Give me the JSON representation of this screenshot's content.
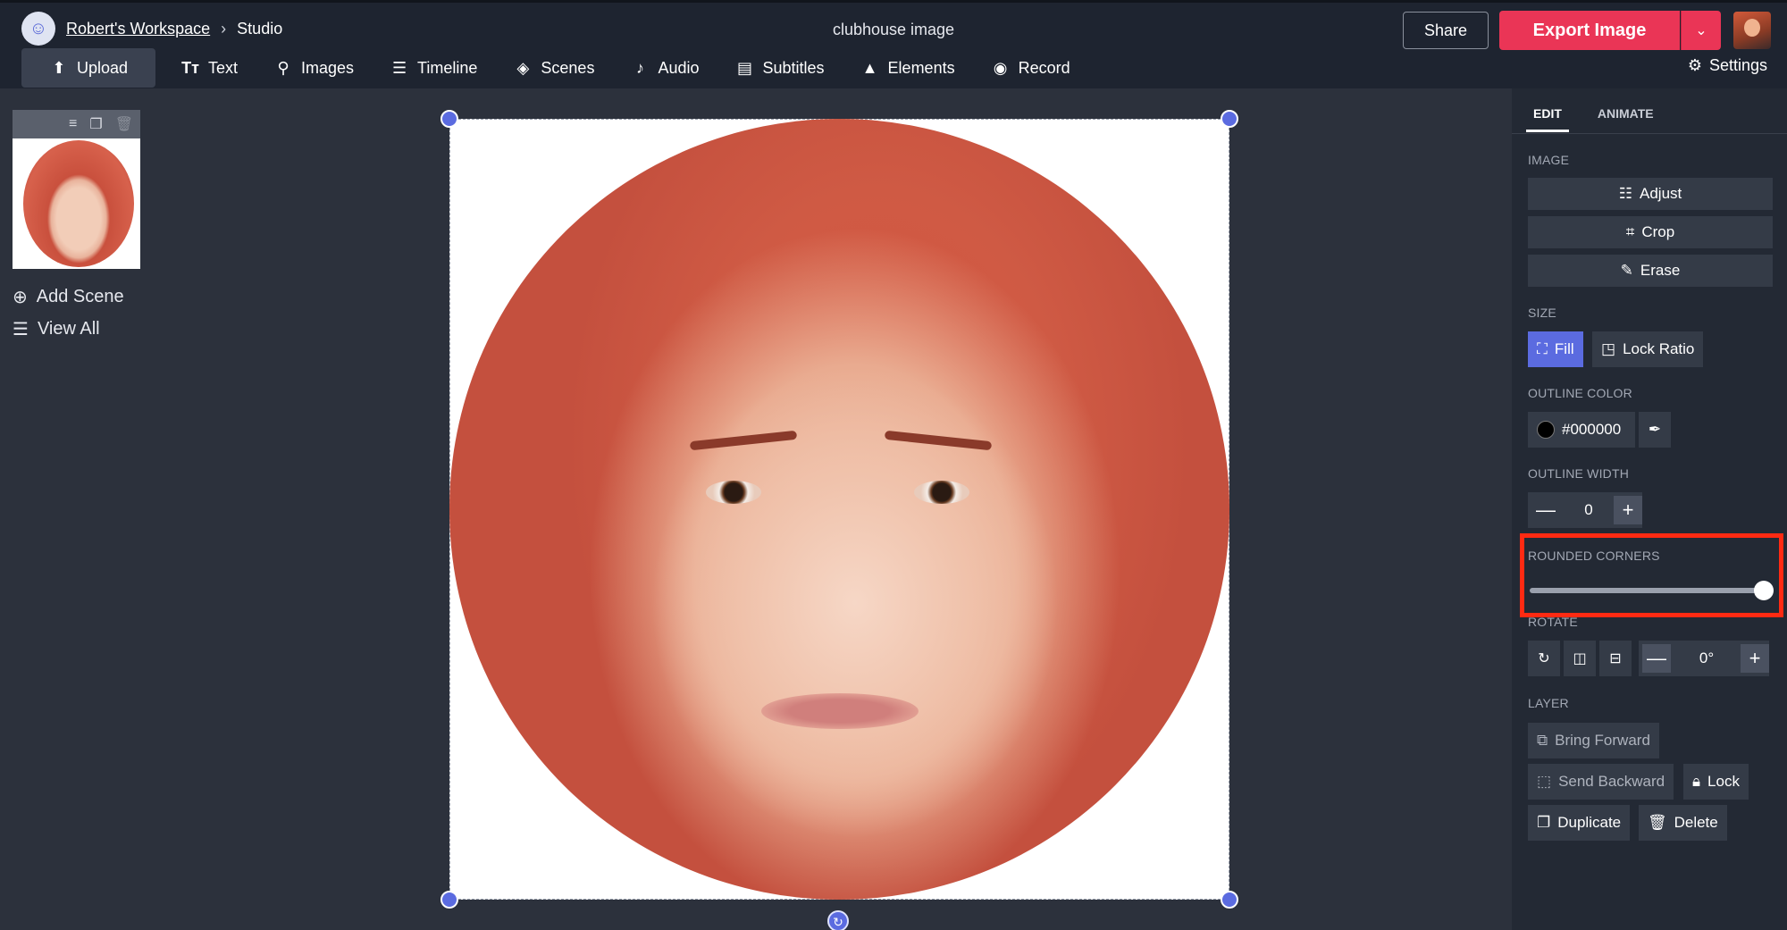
{
  "header": {
    "workspace": "Robert's Workspace",
    "separator": "›",
    "studio": "Studio",
    "doc_title": "clubhouse image",
    "share_label": "Share",
    "export_label": "Export Image",
    "settings_label": "Settings"
  },
  "menu": [
    {
      "label": "Upload",
      "icon": "upload-icon"
    },
    {
      "label": "Text",
      "icon": "text-icon"
    },
    {
      "label": "Images",
      "icon": "search-icon"
    },
    {
      "label": "Timeline",
      "icon": "timeline-icon"
    },
    {
      "label": "Scenes",
      "icon": "layers-icon"
    },
    {
      "label": "Audio",
      "icon": "music-note-icon"
    },
    {
      "label": "Subtitles",
      "icon": "subtitles-icon"
    },
    {
      "label": "Elements",
      "icon": "shapes-icon"
    },
    {
      "label": "Record",
      "icon": "record-icon"
    }
  ],
  "left_panel": {
    "add_scene": "Add Scene",
    "view_all": "View All"
  },
  "right_panel": {
    "tabs": [
      "EDIT",
      "ANIMATE"
    ],
    "image_label": "IMAGE",
    "adjust": "Adjust",
    "crop": "Crop",
    "erase": "Erase",
    "size_label": "SIZE",
    "fill": "Fill",
    "lock_ratio": "Lock Ratio",
    "outline_color_label": "OUTLINE COLOR",
    "outline_color_value": "#000000",
    "outline_width_label": "OUTLINE WIDTH",
    "outline_width_value": "0",
    "rounded_corners_label": "ROUNDED CORNERS",
    "rounded_corners_value": 1.0,
    "rotate_label": "ROTATE",
    "rotate_value": "0°",
    "layer_label": "LAYER",
    "bring_forward": "Bring Forward",
    "send_backward": "Send Backward",
    "lock": "Lock",
    "duplicate": "Duplicate",
    "delete": "Delete"
  },
  "colors": {
    "accent": "#5b6be0",
    "export": "#ea3556",
    "highlight": "#ff2a12"
  }
}
